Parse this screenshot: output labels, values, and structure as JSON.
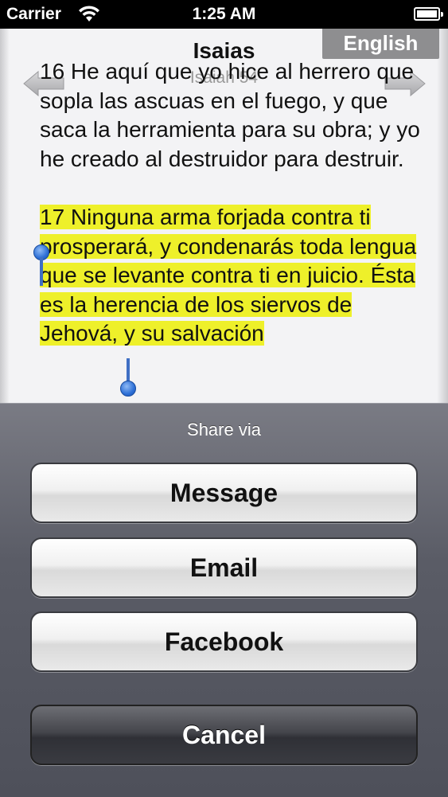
{
  "status_bar": {
    "carrier": "Carrier",
    "time": "1:25 AM"
  },
  "reader": {
    "language_button": "English",
    "book_title": "Isaias",
    "chapter_label": "Isaiah 54",
    "verses": {
      "previous_tail": "16 He aquí que yo hice al herrero que sopla las ascuas en el fuego, y que saca la herramienta para su obra; y yo he creado al destruidor para destruir.",
      "selected": "17 Ninguna arma forjada contra ti prosperará, y condenarás toda lengua que se levante contra ti en juicio. Ésta es la herencia de los siervos de Jehová, y su salvación"
    },
    "highlight_color": "#eef02a",
    "icons": {
      "prev": "arrow-left-icon",
      "next": "arrow-right-icon"
    }
  },
  "share_sheet": {
    "title": "Share via",
    "buttons": {
      "message": "Message",
      "email": "Email",
      "facebook": "Facebook",
      "cancel": "Cancel"
    }
  }
}
